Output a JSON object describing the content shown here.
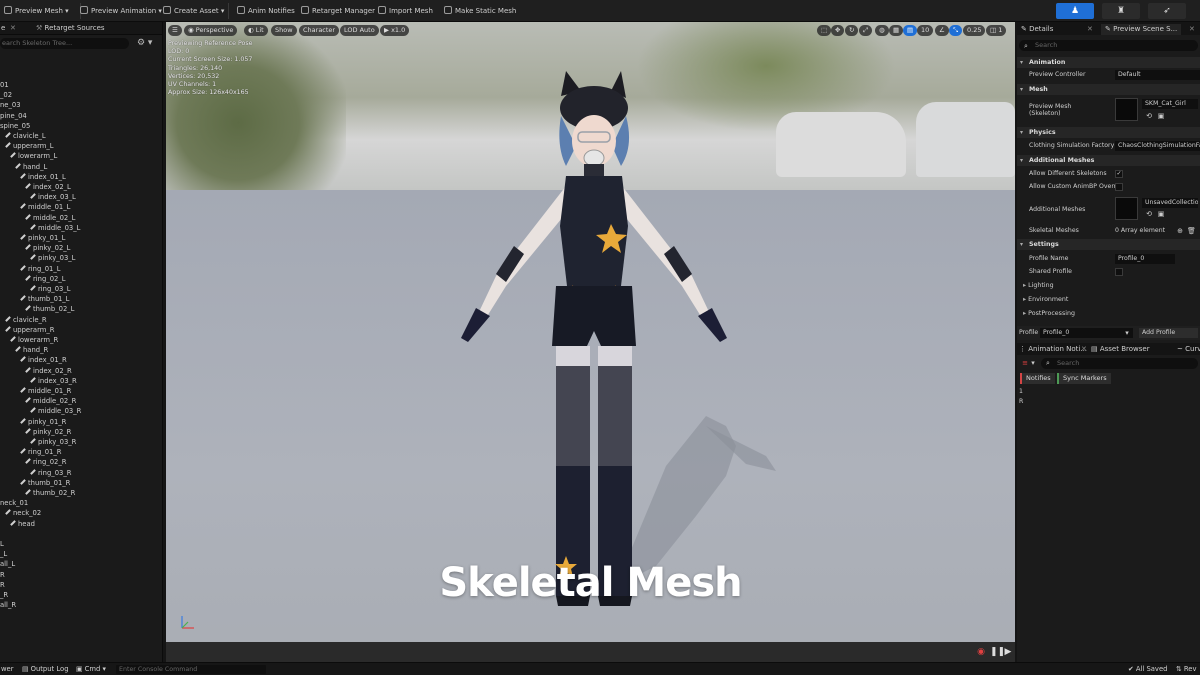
{
  "toolbar": {
    "items": [
      "Preview Mesh",
      "Preview Animation",
      "Create Asset",
      "Anim Notifies",
      "Retarget Manager",
      "Import Mesh",
      "Make Static Mesh"
    ]
  },
  "left_panel": {
    "tab_left": "e",
    "tab_right": "Retarget Sources",
    "search_placeholder": "earch Skeleton Tree...",
    "bones": [
      {
        "label": "01",
        "indent": 0
      },
      {
        "label": "_02",
        "indent": 0
      },
      {
        "label": "ne_03",
        "indent": 0
      },
      {
        "label": "pine_04",
        "indent": 0
      },
      {
        "label": "spine_05",
        "indent": 0
      },
      {
        "label": "clavicle_L",
        "indent": 1
      },
      {
        "label": "upperarm_L",
        "indent": 1
      },
      {
        "label": "lowerarm_L",
        "indent": 2
      },
      {
        "label": "hand_L",
        "indent": 3
      },
      {
        "label": "index_01_L",
        "indent": 4
      },
      {
        "label": "index_02_L",
        "indent": 5
      },
      {
        "label": "index_03_L",
        "indent": 6
      },
      {
        "label": "middle_01_L",
        "indent": 4
      },
      {
        "label": "middle_02_L",
        "indent": 5
      },
      {
        "label": "middle_03_L",
        "indent": 6
      },
      {
        "label": "pinky_01_L",
        "indent": 4
      },
      {
        "label": "pinky_02_L",
        "indent": 5
      },
      {
        "label": "pinky_03_L",
        "indent": 6
      },
      {
        "label": "ring_01_L",
        "indent": 4
      },
      {
        "label": "ring_02_L",
        "indent": 5
      },
      {
        "label": "ring_03_L",
        "indent": 6
      },
      {
        "label": "thumb_01_L",
        "indent": 4
      },
      {
        "label": "thumb_02_L",
        "indent": 5
      },
      {
        "label": "clavicle_R",
        "indent": 1
      },
      {
        "label": "upperarm_R",
        "indent": 1
      },
      {
        "label": "lowerarm_R",
        "indent": 2
      },
      {
        "label": "hand_R",
        "indent": 3
      },
      {
        "label": "index_01_R",
        "indent": 4
      },
      {
        "label": "index_02_R",
        "indent": 5
      },
      {
        "label": "index_03_R",
        "indent": 6
      },
      {
        "label": "middle_01_R",
        "indent": 4
      },
      {
        "label": "middle_02_R",
        "indent": 5
      },
      {
        "label": "middle_03_R",
        "indent": 6
      },
      {
        "label": "pinky_01_R",
        "indent": 4
      },
      {
        "label": "pinky_02_R",
        "indent": 5
      },
      {
        "label": "pinky_03_R",
        "indent": 6
      },
      {
        "label": "ring_01_R",
        "indent": 4
      },
      {
        "label": "ring_02_R",
        "indent": 5
      },
      {
        "label": "ring_03_R",
        "indent": 6
      },
      {
        "label": "thumb_01_R",
        "indent": 4
      },
      {
        "label": "thumb_02_R",
        "indent": 5
      },
      {
        "label": "neck_01",
        "indent": 0
      },
      {
        "label": "neck_02",
        "indent": 1
      },
      {
        "label": "head",
        "indent": 2
      },
      {
        "label": "",
        "indent": 0
      },
      {
        "label": "L",
        "indent": 0
      },
      {
        "label": "_L",
        "indent": 0
      },
      {
        "label": "all_L",
        "indent": 0
      },
      {
        "label": "R",
        "indent": 0
      },
      {
        "label": "R",
        "indent": 0
      },
      {
        "label": "_R",
        "indent": 0
      },
      {
        "label": "all_R",
        "indent": 0
      }
    ]
  },
  "viewport": {
    "buttons": {
      "perspective": "Perspective",
      "lit": "Lit",
      "show": "Show",
      "character": "Character",
      "lod": "LOD Auto",
      "speed": "x1.0"
    },
    "right_icons": {
      "grid": "10",
      "zoom": "0.25",
      "cam": "1"
    },
    "stats": [
      "Previewing Reference Pose",
      "LOD: 0",
      "Current Screen Size: 1.057",
      "Triangles: 26,140",
      "Vertices: 20,532",
      "UV Channels: 1",
      "Approx Size: 126x40x165"
    ],
    "watermark": "Skeletal Mesh"
  },
  "right_panel": {
    "tab_details": "Details",
    "tab_preview": "Preview Scene S...",
    "search_placeholder": "Search",
    "sections": {
      "animation": "Animation",
      "mesh": "Mesh",
      "physics": "Physics",
      "additional": "Additional Meshes",
      "settings": "Settings"
    },
    "props": {
      "preview_controller_label": "Preview Controller",
      "preview_controller_value": "Default",
      "preview_mesh_label": "Preview Mesh",
      "preview_mesh_sub": "(Skeleton)",
      "preview_mesh_value": "SKM_Cat_Girl",
      "cloth_label": "Clothing Simulation Factory",
      "cloth_value": "ChaosClothingSimulationFac",
      "allow_diff_label": "Allow Different Skeletons",
      "allow_custom_label": "Allow Custom AnimBP Overrid",
      "additional_meshes_label": "Additional Meshes",
      "additional_meshes_value": "UnsavedCollection",
      "skeletal_meshes_label": "Skeletal Meshes",
      "skeletal_meshes_value": "0 Array element",
      "profile_name_label": "Profile Name",
      "profile_name_value": "Profile_0",
      "shared_profile_label": "Shared Profile"
    },
    "collapsed": [
      "Lighting",
      "Environment",
      "PostProcessing"
    ],
    "profile_label": "Profile",
    "profile_value": "Profile_0",
    "add_profile": "Add Profile",
    "anim_tabs": [
      "Animation Noti...",
      "Asset Browser",
      "Curve"
    ],
    "anim_search": "Search",
    "notifies": "Notifies",
    "sync_markers": "Sync Markers",
    "notif_rows": [
      "1",
      "R"
    ]
  },
  "status_bar": {
    "left": "wer",
    "output_log": "Output Log",
    "cmd": "Cmd",
    "console_placeholder": "Enter Console Command",
    "all_saved": "All Saved",
    "rev": "Rev"
  },
  "colors": {
    "accent_blue": "#1f6fd6",
    "notifies_red": "#d44545",
    "sync_green": "#4d9a55",
    "record_red": "#e04040"
  }
}
